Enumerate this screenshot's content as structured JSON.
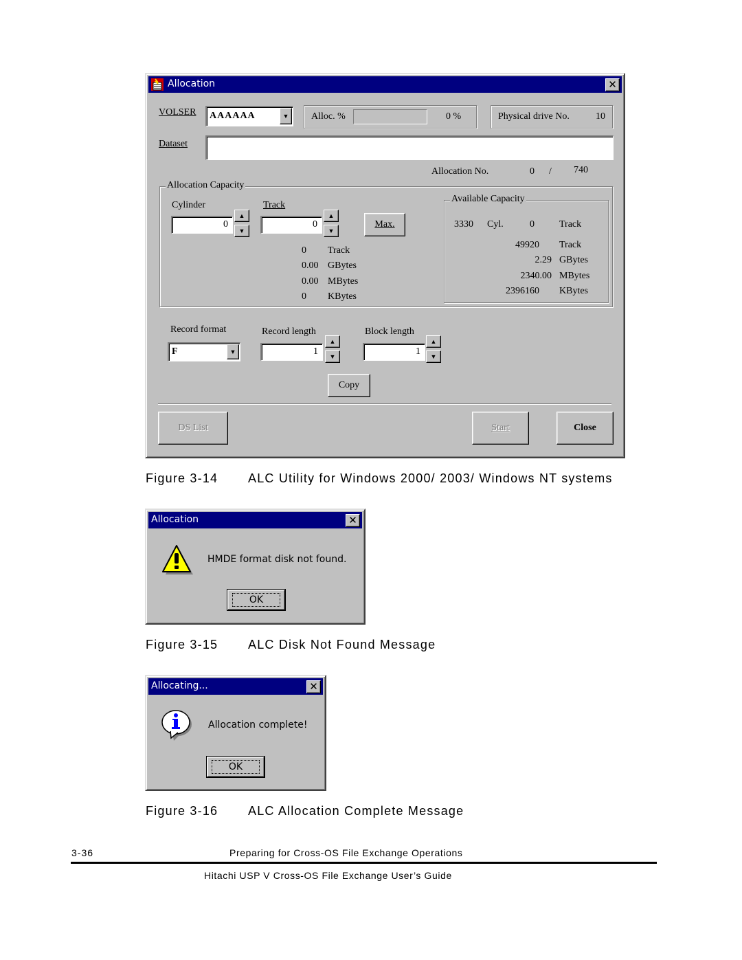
{
  "figure14": {
    "caption_num": "Figure 3-14",
    "caption_text": "ALC Utility for Windows 2000/ 2003/ Windows NT systems",
    "window": {
      "title": "Allocation",
      "volser_label": "VOLSER",
      "volser_value": "AAAAAA",
      "alloc_pct_label": "Alloc. %",
      "alloc_pct_value": "0 %",
      "alloc_progress_fraction": 0,
      "physical_drive_label": "Physical drive No.",
      "physical_drive_value": "10",
      "dataset_label": "Dataset",
      "dataset_value": "",
      "allocation_no_label": "Allocation No.",
      "allocation_no_current": "0",
      "allocation_no_sep": "/",
      "allocation_no_total": "740",
      "alloc_capacity": {
        "legend": "Allocation Capacity",
        "cylinder_label": "Cylinder",
        "cylinder_value": "0",
        "track_label": "Track",
        "track_value": "0",
        "max_button": "Max.",
        "results": [
          {
            "value": "0",
            "unit": "Track"
          },
          {
            "value": "0.00",
            "unit": "GBytes"
          },
          {
            "value": "0.00",
            "unit": "MBytes"
          },
          {
            "value": "0",
            "unit": "KBytes"
          }
        ]
      },
      "available_capacity": {
        "legend": "Available Capacity",
        "cyl_value": "3330",
        "cyl_unit": "Cyl.",
        "track_value": "0",
        "track_unit": "Track",
        "rows": [
          {
            "value": "49920",
            "unit": "Track"
          },
          {
            "value": "2.29",
            "unit": "GBytes"
          },
          {
            "value": "2340.00",
            "unit": "MBytes"
          },
          {
            "value": "2396160",
            "unit": "KBytes"
          }
        ]
      },
      "record_format_label": "Record format",
      "record_format_value": "F",
      "record_length_label": "Record length",
      "record_length_value": "1",
      "block_length_label": "Block length",
      "block_length_value": "1",
      "copy_button": "Copy",
      "ds_list_button": "DS List",
      "start_button": "Start",
      "close_button": "Close"
    }
  },
  "figure15": {
    "caption_num": "Figure 3-15",
    "caption_text": "ALC Disk Not Found Message",
    "window": {
      "title": "Allocation",
      "message": "HMDE format disk not found.",
      "ok_button": "OK",
      "icon": "warning-icon"
    }
  },
  "figure16": {
    "caption_num": "Figure 3-16",
    "caption_text": "ALC Allocation Complete Message",
    "window": {
      "title": "Allocating...",
      "message": "Allocation complete!",
      "ok_button": "OK",
      "icon": "info-icon"
    }
  },
  "footer": {
    "page_number": "3-36",
    "section": "Preparing for Cross-OS File Exchange Operations",
    "guide_title": "Hitachi USP V Cross-OS File Exchange User’s Guide"
  },
  "glyphs": {
    "close": "✕",
    "up": "▲",
    "down": "▼"
  }
}
